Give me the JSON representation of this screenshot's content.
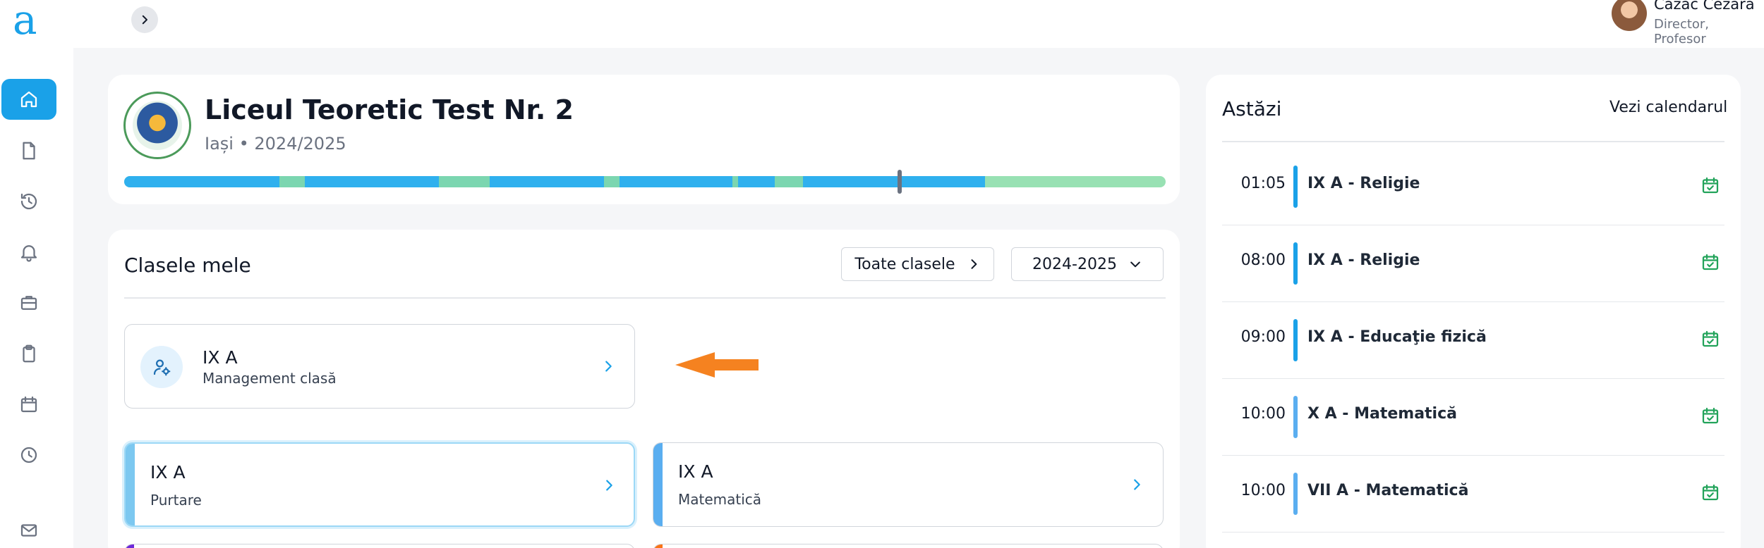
{
  "app": {
    "logo_letter": "a"
  },
  "user": {
    "name": "Cazac Cezara",
    "role": "Director, Profesor"
  },
  "nav": {
    "items": [
      {
        "icon": "home-icon",
        "active": true
      },
      {
        "icon": "document-icon",
        "active": false
      },
      {
        "icon": "history-icon",
        "active": false
      },
      {
        "icon": "bell-icon",
        "active": false
      },
      {
        "icon": "briefcase-icon",
        "active": false
      },
      {
        "icon": "clipboard-icon",
        "active": false
      },
      {
        "icon": "calendar-icon",
        "active": false
      },
      {
        "icon": "clock-icon",
        "active": false
      },
      {
        "icon": "mail-icon",
        "active": false
      }
    ]
  },
  "school": {
    "name": "Liceul Teoretic Test Nr. 2",
    "subtitle": "Iași • 2024/2025"
  },
  "classes": {
    "title": "Clasele mele",
    "all_button": "Toate clasele",
    "year_select": "2024-2025",
    "management": {
      "title": "IX A",
      "subtitle": "Management clasă"
    },
    "cards": [
      {
        "title": "IX A",
        "subtitle": "Purtare",
        "accent": "#7cc8f0",
        "selected": true
      },
      {
        "title": "IX A",
        "subtitle": "Matematică",
        "accent": "#5aaef0",
        "selected": false
      }
    ],
    "peek_accents": [
      "#6d28d9",
      "#f97316"
    ]
  },
  "today": {
    "title": "Astăzi",
    "calendar_link": "Vezi calendarul",
    "events": [
      {
        "time": "01:05",
        "title": "IX A - Religie"
      },
      {
        "time": "08:00",
        "title": "IX A - Religie"
      },
      {
        "time": "09:00",
        "title": "IX A - Educaţie fizică"
      },
      {
        "time": "10:00",
        "title": "X A - Matematică"
      },
      {
        "time": "10:00",
        "title": "VII A - Matematică"
      }
    ]
  },
  "colors": {
    "primary": "#1aa1e8",
    "progress_blue": "#2fb0ee",
    "progress_green": "#98e1b3",
    "event_icon": "#22a35a",
    "arrow": "#f58220"
  }
}
